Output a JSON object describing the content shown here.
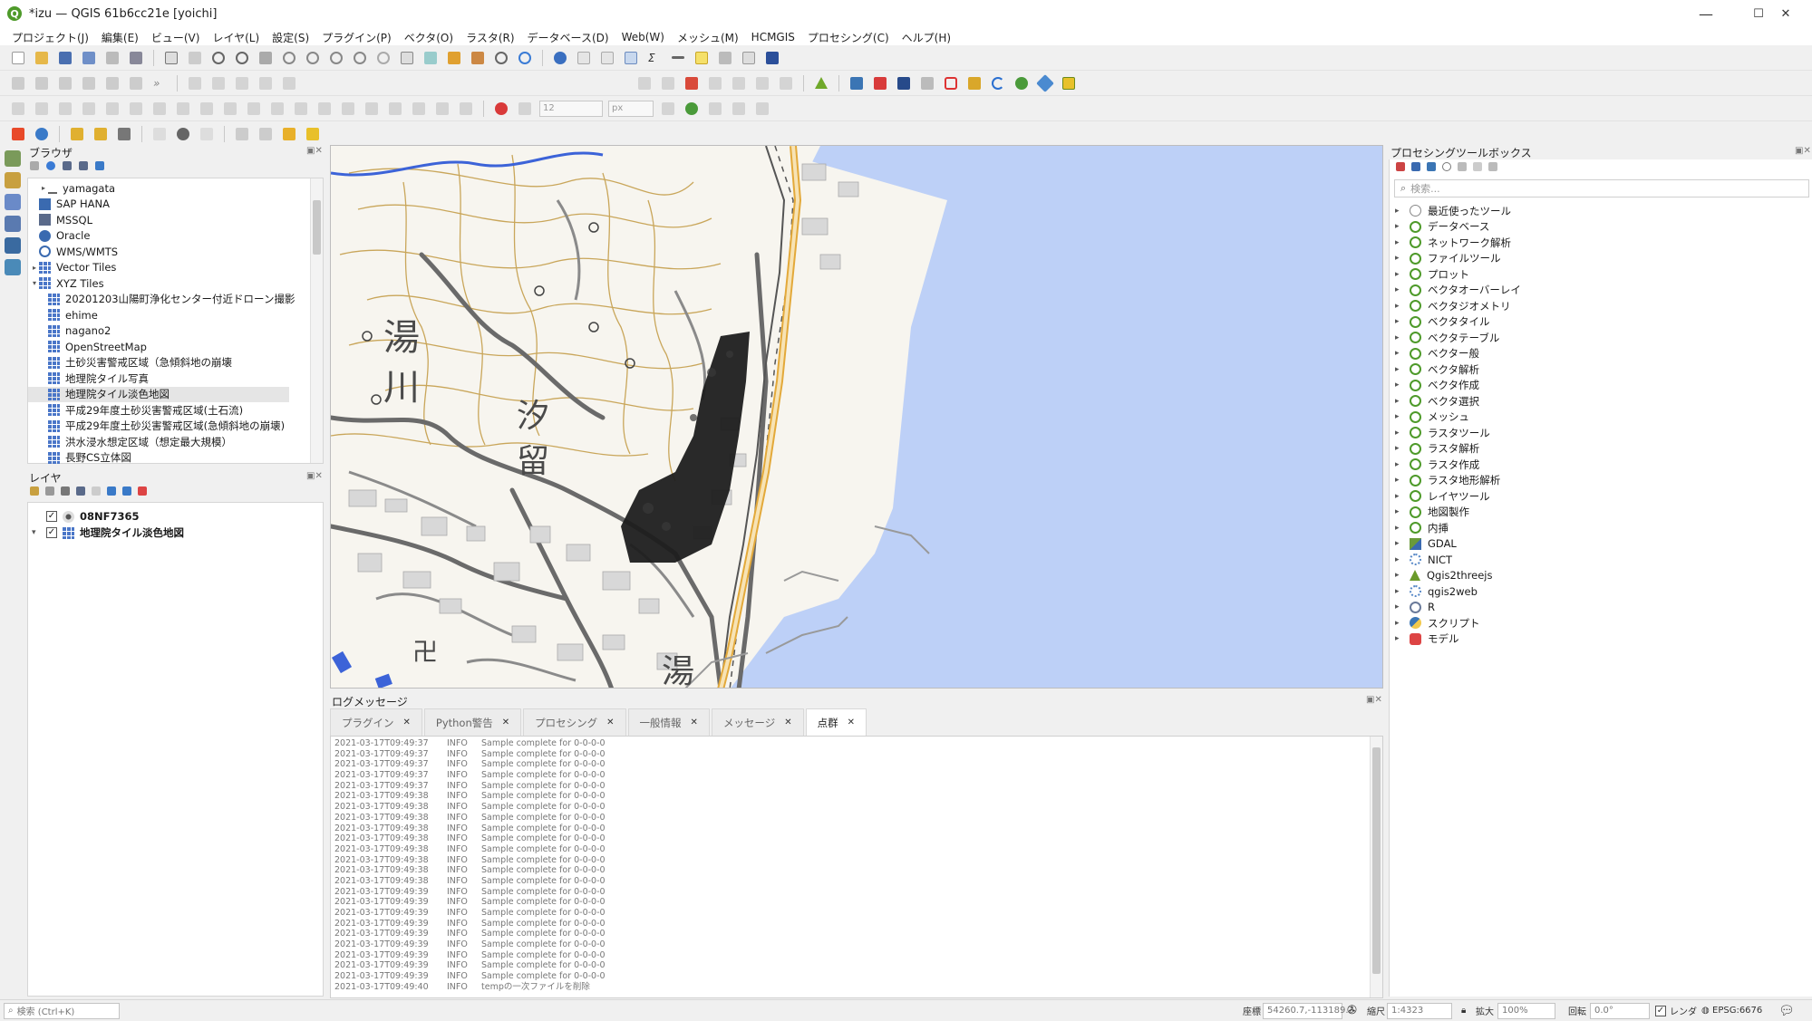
{
  "window": {
    "title": "*izu — QGIS 61b6cc21e [yoichi]",
    "minimize": "—",
    "maximize": "☐",
    "close": "✕"
  },
  "menu": [
    "プロジェクト(J)",
    "編集(E)",
    "ビュー(V)",
    "レイヤ(L)",
    "設定(S)",
    "プラグイン(P)",
    "ベクタ(O)",
    "ラスタ(R)",
    "データベース(D)",
    "Web(W)",
    "メッシュ(M)",
    "HCMGIS",
    "プロセシング(C)",
    "ヘルプ(H)"
  ],
  "toolbar": {
    "snap_value": "12",
    "snap_unit": "px"
  },
  "browser": {
    "title": "ブラウザ",
    "items": [
      {
        "label": "yamagata",
        "indent": 1,
        "arrow": "▸"
      },
      {
        "label": "SAP HANA",
        "indent": 0,
        "arrow": ""
      },
      {
        "label": "MSSQL",
        "indent": 0,
        "arrow": ""
      },
      {
        "label": "Oracle",
        "indent": 0,
        "arrow": ""
      },
      {
        "label": "WMS/WMTS",
        "indent": 0,
        "arrow": ""
      },
      {
        "label": "Vector Tiles",
        "indent": 0,
        "arrow": "▸"
      },
      {
        "label": "XYZ Tiles",
        "indent": 0,
        "arrow": "▾"
      },
      {
        "label": "20201203山陽町浄化センター付近ドローン撮影",
        "indent": 1,
        "arrow": ""
      },
      {
        "label": "ehime",
        "indent": 1,
        "arrow": ""
      },
      {
        "label": "nagano2",
        "indent": 1,
        "arrow": ""
      },
      {
        "label": "OpenStreetMap",
        "indent": 1,
        "arrow": ""
      },
      {
        "label": "土砂災害警戒区域（急傾斜地の崩壊",
        "indent": 1,
        "arrow": ""
      },
      {
        "label": "地理院タイル写真",
        "indent": 1,
        "arrow": ""
      },
      {
        "label": "地理院タイル淡色地図",
        "indent": 1,
        "arrow": "",
        "selected": true
      },
      {
        "label": "平成29年度土砂災害警戒区域(土石流)",
        "indent": 1,
        "arrow": ""
      },
      {
        "label": "平成29年度土砂災害警戒区域(急傾斜地の崩壊)",
        "indent": 1,
        "arrow": ""
      },
      {
        "label": "洪水浸水想定区域（想定最大規模）",
        "indent": 1,
        "arrow": ""
      },
      {
        "label": "長野CS立体図",
        "indent": 1,
        "arrow": ""
      }
    ]
  },
  "layers": {
    "title": "レイヤ",
    "items": [
      {
        "label": "08NF7365",
        "checked": "✓"
      },
      {
        "label": "地理院タイル淡色地図",
        "checked": "✓"
      }
    ]
  },
  "map": {
    "labels": [
      "湯",
      "川",
      "汐",
      "留",
      "湯",
      "卍"
    ]
  },
  "log": {
    "title": "ログメッセージ",
    "tabs": [
      "プラグイン",
      "Python警告",
      "プロセシング",
      "一般情報",
      "メッセージ",
      "点群"
    ],
    "active_tab": 5,
    "lines": [
      {
        "time": "2021-03-17T09:49:37",
        "level": "INFO",
        "msg": "Sample complete for 0-0-0-0"
      },
      {
        "time": "2021-03-17T09:49:37",
        "level": "INFO",
        "msg": "Sample complete for 0-0-0-0"
      },
      {
        "time": "2021-03-17T09:49:37",
        "level": "INFO",
        "msg": "Sample complete for 0-0-0-0"
      },
      {
        "time": "2021-03-17T09:49:37",
        "level": "INFO",
        "msg": "Sample complete for 0-0-0-0"
      },
      {
        "time": "2021-03-17T09:49:37",
        "level": "INFO",
        "msg": "Sample complete for 0-0-0-0"
      },
      {
        "time": "2021-03-17T09:49:38",
        "level": "INFO",
        "msg": "Sample complete for 0-0-0-0"
      },
      {
        "time": "2021-03-17T09:49:38",
        "level": "INFO",
        "msg": "Sample complete for 0-0-0-0"
      },
      {
        "time": "2021-03-17T09:49:38",
        "level": "INFO",
        "msg": "Sample complete for 0-0-0-0"
      },
      {
        "time": "2021-03-17T09:49:38",
        "level": "INFO",
        "msg": "Sample complete for 0-0-0-0"
      },
      {
        "time": "2021-03-17T09:49:38",
        "level": "INFO",
        "msg": "Sample complete for 0-0-0-0"
      },
      {
        "time": "2021-03-17T09:49:38",
        "level": "INFO",
        "msg": "Sample complete for 0-0-0-0"
      },
      {
        "time": "2021-03-17T09:49:38",
        "level": "INFO",
        "msg": "Sample complete for 0-0-0-0"
      },
      {
        "time": "2021-03-17T09:49:38",
        "level": "INFO",
        "msg": "Sample complete for 0-0-0-0"
      },
      {
        "time": "2021-03-17T09:49:38",
        "level": "INFO",
        "msg": "Sample complete for 0-0-0-0"
      },
      {
        "time": "2021-03-17T09:49:39",
        "level": "INFO",
        "msg": "Sample complete for 0-0-0-0"
      },
      {
        "time": "2021-03-17T09:49:39",
        "level": "INFO",
        "msg": "Sample complete for 0-0-0-0"
      },
      {
        "time": "2021-03-17T09:49:39",
        "level": "INFO",
        "msg": "Sample complete for 0-0-0-0"
      },
      {
        "time": "2021-03-17T09:49:39",
        "level": "INFO",
        "msg": "Sample complete for 0-0-0-0"
      },
      {
        "time": "2021-03-17T09:49:39",
        "level": "INFO",
        "msg": "Sample complete for 0-0-0-0"
      },
      {
        "time": "2021-03-17T09:49:39",
        "level": "INFO",
        "msg": "Sample complete for 0-0-0-0"
      },
      {
        "time": "2021-03-17T09:49:39",
        "level": "INFO",
        "msg": "Sample complete for 0-0-0-0"
      },
      {
        "time": "2021-03-17T09:49:39",
        "level": "INFO",
        "msg": "Sample complete for 0-0-0-0"
      },
      {
        "time": "2021-03-17T09:49:39",
        "level": "INFO",
        "msg": "Sample complete for 0-0-0-0"
      },
      {
        "time": "2021-03-17T09:49:40",
        "level": "INFO",
        "msg": "tempの一次ファイルを削除"
      }
    ]
  },
  "toolbox": {
    "title": "プロセシングツールボックス",
    "search_placeholder": "検索...",
    "items": [
      {
        "label": "最近使ったツール",
        "icon": "clock"
      },
      {
        "label": "データベース",
        "icon": "qgis"
      },
      {
        "label": "ネットワーク解析",
        "icon": "qgis"
      },
      {
        "label": "ファイルツール",
        "icon": "qgis"
      },
      {
        "label": "プロット",
        "icon": "qgis"
      },
      {
        "label": "ベクタオーバーレイ",
        "icon": "qgis"
      },
      {
        "label": "ベクタジオメトリ",
        "icon": "qgis"
      },
      {
        "label": "ベクタタイル",
        "icon": "qgis"
      },
      {
        "label": "ベクタテーブル",
        "icon": "qgis"
      },
      {
        "label": "ベクター般",
        "icon": "qgis"
      },
      {
        "label": "ベクタ解析",
        "icon": "qgis"
      },
      {
        "label": "ベクタ作成",
        "icon": "qgis"
      },
      {
        "label": "ベクタ選択",
        "icon": "qgis"
      },
      {
        "label": "メッシュ",
        "icon": "qgis"
      },
      {
        "label": "ラスタツール",
        "icon": "qgis"
      },
      {
        "label": "ラスタ解析",
        "icon": "qgis"
      },
      {
        "label": "ラスタ作成",
        "icon": "qgis"
      },
      {
        "label": "ラスタ地形解析",
        "icon": "qgis"
      },
      {
        "label": "レイヤツール",
        "icon": "qgis"
      },
      {
        "label": "地図製作",
        "icon": "qgis"
      },
      {
        "label": "内挿",
        "icon": "qgis"
      },
      {
        "label": "GDAL",
        "icon": "gdal"
      },
      {
        "label": "NICT",
        "icon": "gear"
      },
      {
        "label": "Qgis2threejs",
        "icon": "triangle"
      },
      {
        "label": "qgis2web",
        "icon": "gear"
      },
      {
        "label": "R",
        "icon": "r"
      },
      {
        "label": "スクリプト",
        "icon": "python"
      },
      {
        "label": "モデル",
        "icon": "model"
      }
    ]
  },
  "statusbar": {
    "search_placeholder": "検索 (Ctrl+K)",
    "coord_label": "座標",
    "coord_value": "54260.7,-113189.3",
    "scale_label": "縮尺",
    "scale_value": "1:4323",
    "magnifier_label": "拡大",
    "magnifier_value": "100%",
    "rotation_label": "回転",
    "rotation_value": "0.0°",
    "render_label": "レンダ",
    "crs": "EPSG:6676"
  }
}
